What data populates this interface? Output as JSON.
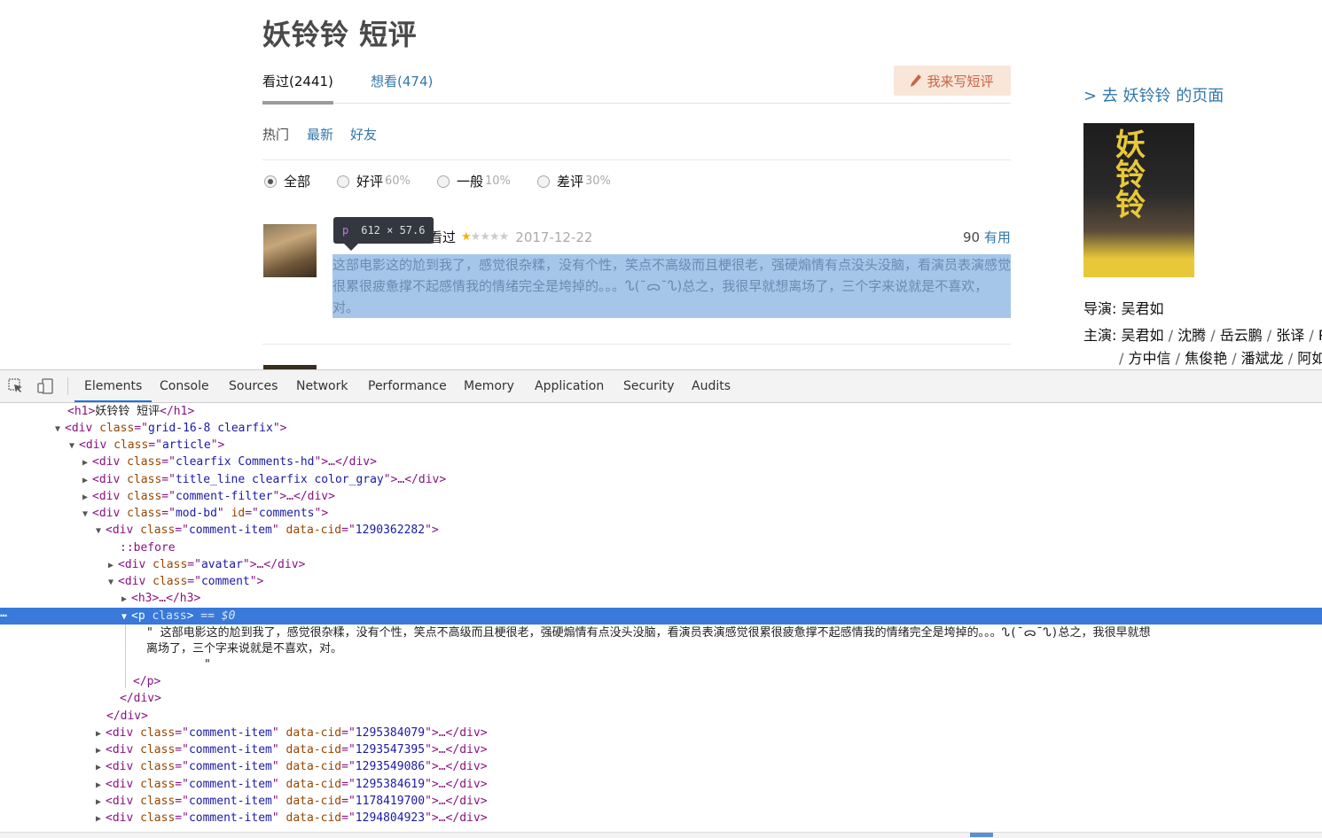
{
  "page": {
    "title": "妖铃铃 短评",
    "tabs": [
      {
        "label": "看过(2441)"
      },
      {
        "label": "想看(474)"
      }
    ],
    "write_button": "我来写短评",
    "sort": [
      "热门",
      "最新",
      "好友"
    ],
    "filters": [
      {
        "label": "全部",
        "pct": ""
      },
      {
        "label": "好评",
        "pct": "60%"
      },
      {
        "label": "一般",
        "pct": "10%"
      },
      {
        "label": "差评",
        "pct": "30%"
      }
    ],
    "comment": {
      "status": "看过",
      "rating_stars": 1,
      "date": "2017-12-22",
      "votes": "90",
      "votes_label": "有用",
      "text": "这部电影这的尬到我了，感觉很杂糅，没有个性，笑点不高级而且梗很老，强硬煽情有点没头没脑，看演员表演感觉很累很疲惫撑不起感情我的情绪完全是垮掉的。。。ᔐ(¯ᯅ¯ᔐ)总之，我很早就想离场了，三个字来说就是不喜欢，对。"
    },
    "inspector_tooltip": {
      "tag": "p",
      "size": "612 × 57.6"
    },
    "sidebar": {
      "goto": "> 去 妖铃铃 的页面",
      "poster_text": "妖铃铃",
      "director_label": "导演",
      "director": "吴君如",
      "cast_label": "主演",
      "cast_line1": [
        "吴君如",
        "沈腾",
        "岳云鹏",
        "张译",
        "P"
      ],
      "cast_line2": [
        "方中信",
        "焦俊艳",
        "潘斌龙",
        "阿如"
      ]
    }
  },
  "devtools": {
    "tabs": [
      "Elements",
      "Console",
      "Sources",
      "Network",
      "Performance",
      "Memory",
      "Application",
      "Security",
      "Audits"
    ],
    "active_tab": "Elements",
    "lines": {
      "l1_open": "<h1>",
      "l1_text": "妖铃铃 短评",
      "l1_close": "</h1>",
      "grid_class": "grid-16-8 clearfix",
      "article_class": "article",
      "comments_hd_class": "clearfix Comments-hd",
      "title_line_class": "title_line clearfix color_gray",
      "comment_filter_class": "comment-filter",
      "mod_bd_class": "mod-bd",
      "mod_bd_id": "comments",
      "comment_item_class": "comment-item",
      "cid_open": "1290362282",
      "before": "::before",
      "avatar_class": "avatar",
      "comment_class": "comment",
      "h3": "<h3>…</h3>",
      "p_tag": "p",
      "p_class_attr": "class",
      "sel_marker": "== $0",
      "p_text_line1": "\" 这部电影这的尬到我了，感觉很杂糅，没有个性，笑点不高级而且梗很老，强硬煽情有点没头没脑，看演员表演感觉很累很疲惫撑不起感情我的情绪完全是垮掉的。。。ᔐ(¯ᯅ¯ᔐ)总之，我很早就想",
      "p_text_line2": "离场了，三个字来说就是不喜欢，对。",
      "p_text_line3": "\"",
      "p_close": "</p>",
      "div_close": "</div>",
      "collapsed_cids": [
        "1295384079",
        "1293547395",
        "1293549086",
        "1295384619",
        "1178419700",
        "1294804923"
      ]
    }
  }
}
